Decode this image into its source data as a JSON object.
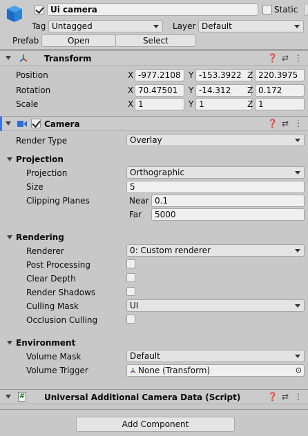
{
  "header": {
    "active": true,
    "name": "Ui camera",
    "static_label": "Static",
    "tag_label": "Tag",
    "tag_value": "Untagged",
    "layer_label": "Layer",
    "layer_value": "Default",
    "prefab_label": "Prefab",
    "open_label": "Open",
    "select_label": "Select"
  },
  "transform": {
    "title": "Transform",
    "position_label": "Position",
    "rotation_label": "Rotation",
    "scale_label": "Scale",
    "x_label": "X",
    "y_label": "Y",
    "z_label": "Z",
    "position": {
      "x": "-977.2108",
      "y": "-153.3922",
      "z": "220.3975"
    },
    "rotation": {
      "x": "70.47501",
      "y": "-14.312",
      "z": "0.172"
    },
    "scale": {
      "x": "1",
      "y": "1",
      "z": "1"
    }
  },
  "camera": {
    "title": "Camera",
    "render_type_label": "Render Type",
    "render_type_value": "Overlay",
    "projection_section": "Projection",
    "projection_label": "Projection",
    "projection_value": "Orthographic",
    "size_label": "Size",
    "size_value": "5",
    "clipping_label": "Clipping Planes",
    "near_label": "Near",
    "near_value": "0.1",
    "far_label": "Far",
    "far_value": "5000",
    "rendering_section": "Rendering",
    "renderer_label": "Renderer",
    "renderer_value": "0: Custom renderer",
    "post_processing_label": "Post Processing",
    "clear_depth_label": "Clear Depth",
    "render_shadows_label": "Render Shadows",
    "culling_mask_label": "Culling Mask",
    "culling_mask_value": "UI",
    "occlusion_label": "Occlusion Culling",
    "environment_section": "Environment",
    "volume_mask_label": "Volume Mask",
    "volume_mask_value": "Default",
    "volume_trigger_label": "Volume Trigger",
    "volume_trigger_value": "None (Transform)"
  },
  "additional": {
    "title": "Universal Additional Camera Data (Script)"
  },
  "add_component_label": "Add Component",
  "icons": {
    "help": "help-icon",
    "presets": "presets-icon",
    "menu": "kebab-menu-icon"
  }
}
